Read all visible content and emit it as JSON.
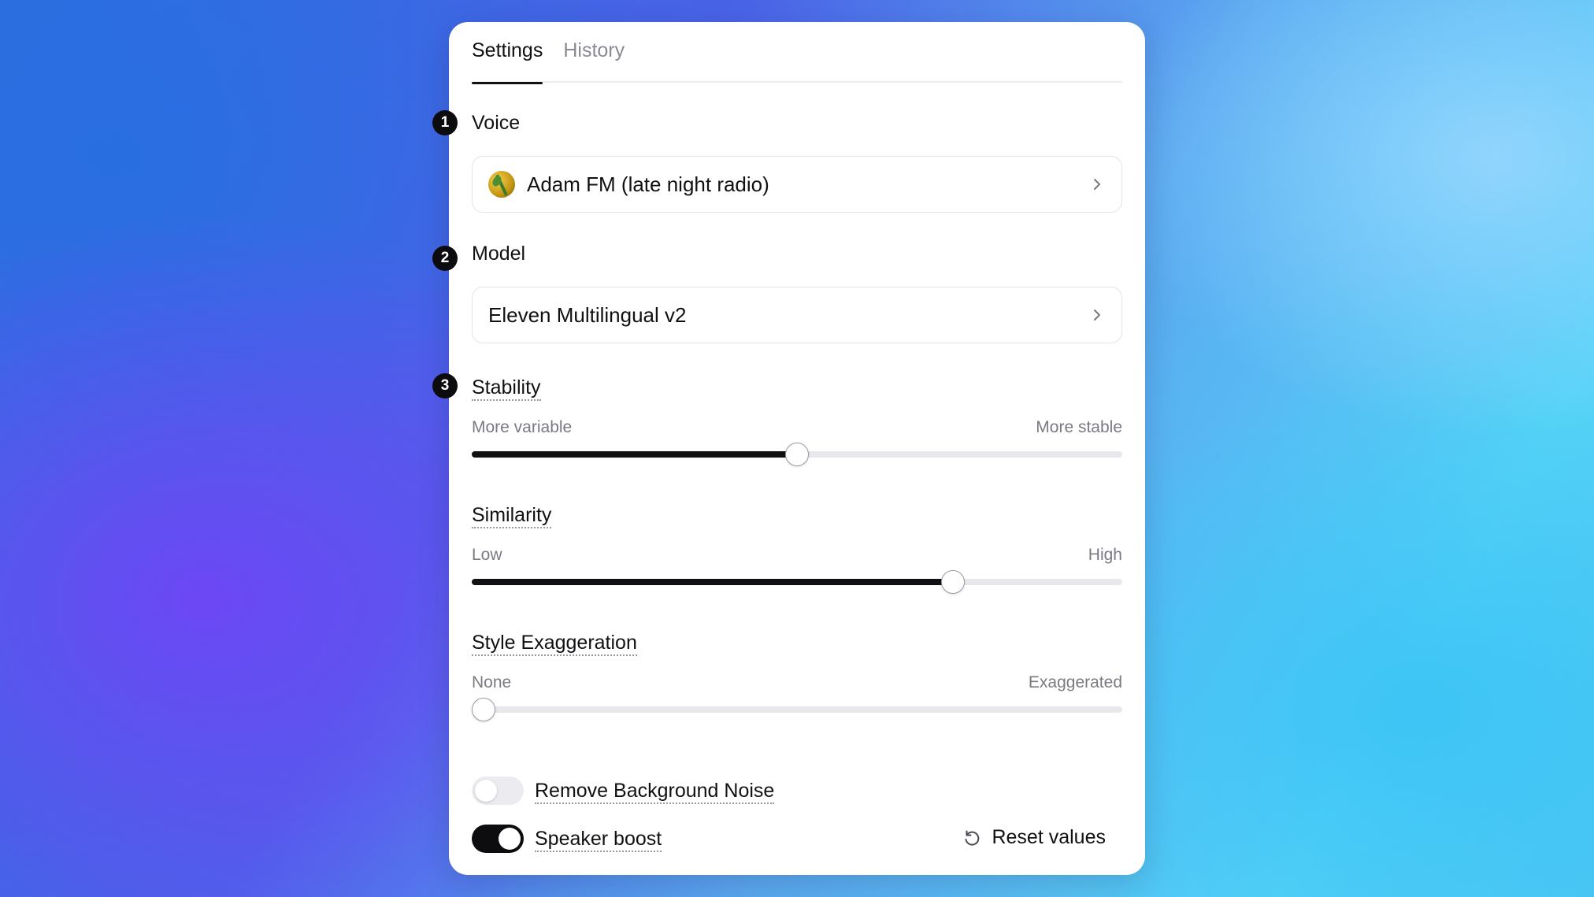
{
  "tabs": [
    {
      "label": "Settings",
      "active": true
    },
    {
      "label": "History",
      "active": false
    }
  ],
  "steps": [
    "1",
    "2",
    "3"
  ],
  "voice": {
    "label": "Voice",
    "value": "Adam FM (late night radio)",
    "avatar_icon": "voice-avatar"
  },
  "model": {
    "label": "Model",
    "value": "Eleven Multilingual v2"
  },
  "sliders": {
    "stability": {
      "label": "Stability",
      "min_label": "More variable",
      "max_label": "More stable",
      "value": 0.5
    },
    "similarity": {
      "label": "Similarity",
      "min_label": "Low",
      "max_label": "High",
      "value": 0.74
    },
    "style": {
      "label": "Style Exaggeration",
      "min_label": "None",
      "max_label": "Exaggerated",
      "value": 0.0
    }
  },
  "toggles": {
    "remove_noise": {
      "label": "Remove Background Noise",
      "on": false
    },
    "speaker_boost": {
      "label": "Speaker boost",
      "on": true
    }
  },
  "reset": {
    "label": "Reset values",
    "icon": "reset-icon"
  },
  "colors": {
    "accent": "#111114",
    "track": "#e7e7ec",
    "muted_text": "#7a7a83"
  }
}
